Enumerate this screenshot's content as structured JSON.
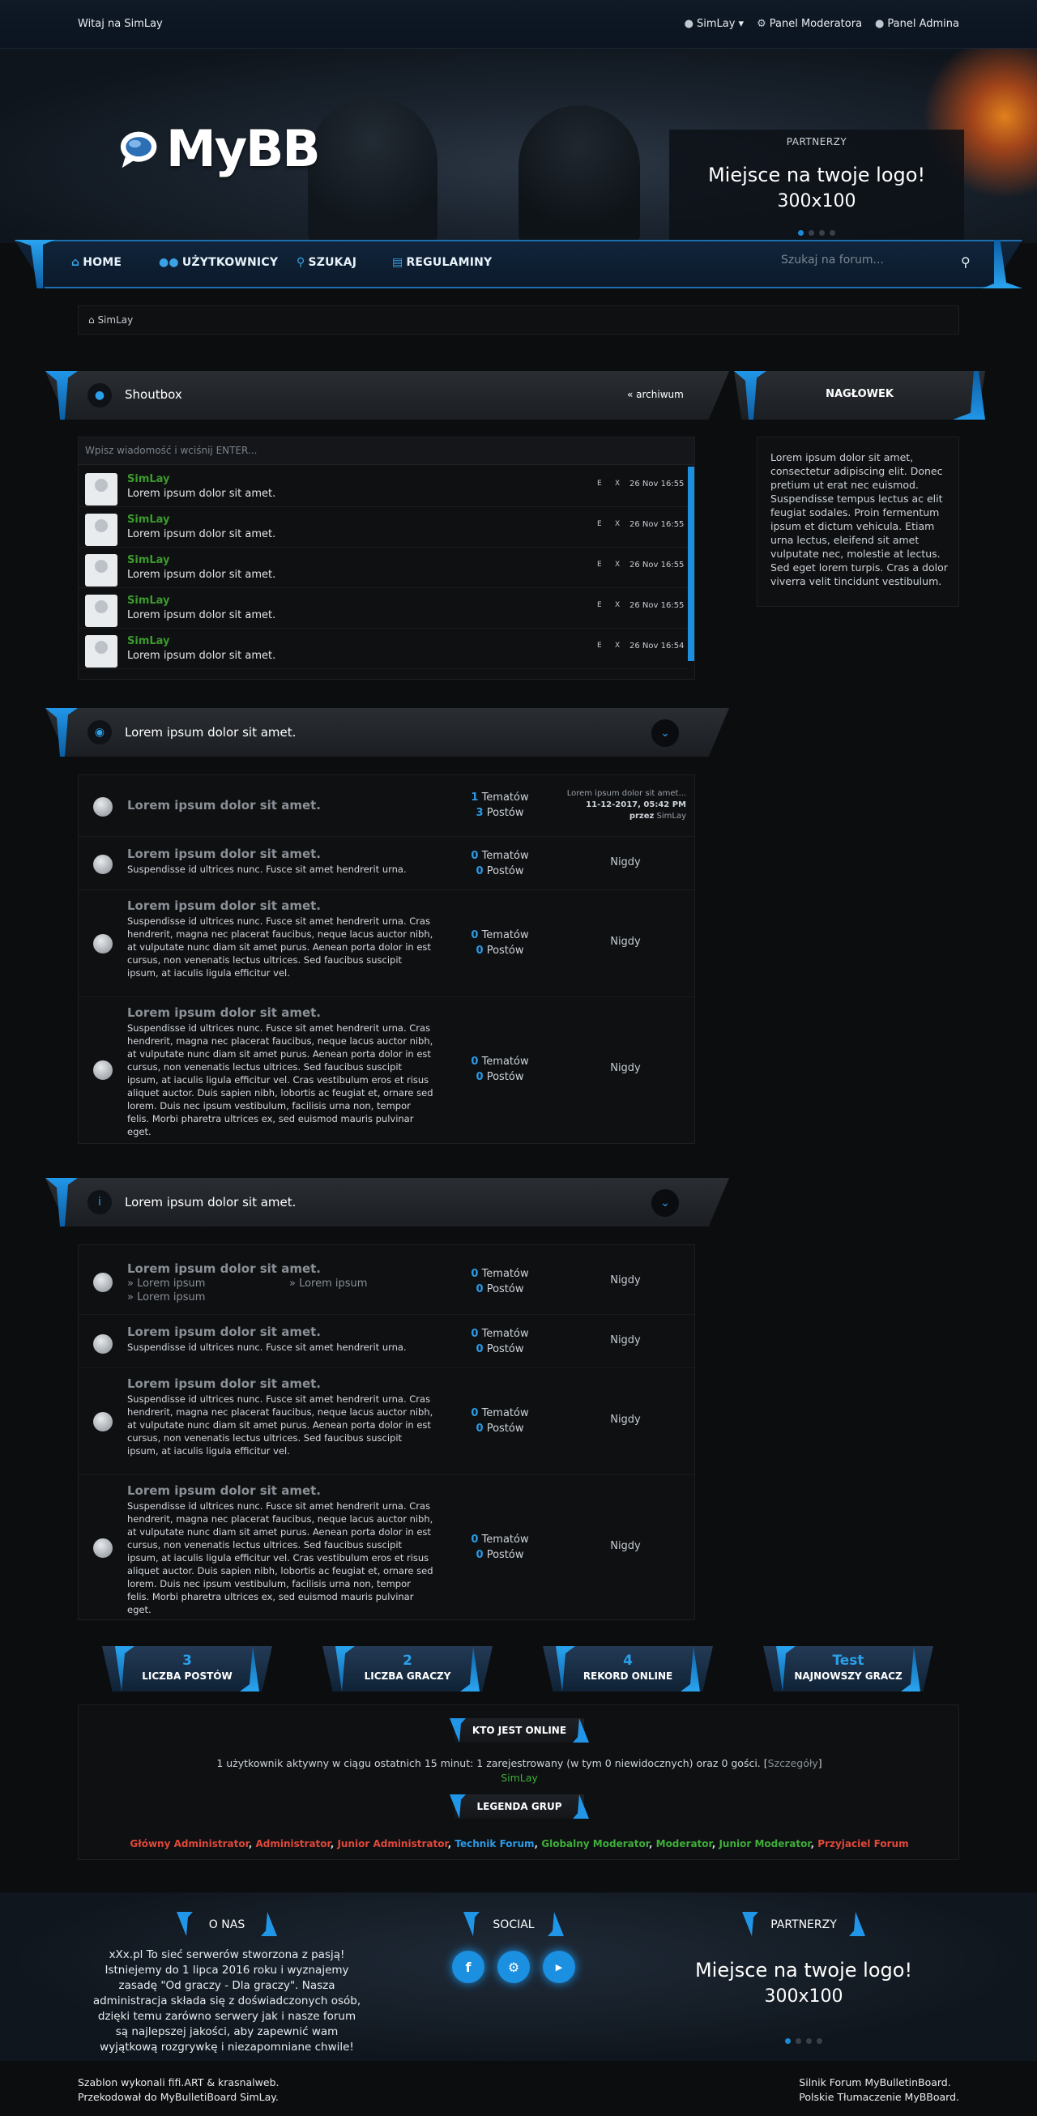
{
  "topbar": {
    "welcome": "Witaj na SimLay",
    "user": "SimLay",
    "moderator": "Panel Moderatora",
    "admin": "Panel Admina"
  },
  "header": {
    "logo": "MyBB",
    "partners_title": "PARTNERZY",
    "partners_line1": "Miejsce na twoje logo!",
    "partners_line2": "300x100"
  },
  "nav": {
    "items": [
      "HOME",
      "UŻYTKOWNICY",
      "SZUKAJ",
      "REGULAMINY"
    ],
    "search_placeholder": "Szukaj na forum..."
  },
  "breadcrumb": "SimLay",
  "shoutbox": {
    "title": "Shoutbox",
    "archive": "« archiwum",
    "input_placeholder": "Wpisz wiadomość i wciśnij ENTER...",
    "rows": [
      {
        "user": "SimLay",
        "message": "Lorem ipsum dolor sit amet.",
        "e": "E",
        "x": "X",
        "date": "26 Nov 16:55"
      },
      {
        "user": "SimLay",
        "message": "Lorem ipsum dolor sit amet.",
        "e": "E",
        "x": "X",
        "date": "26 Nov 16:55"
      },
      {
        "user": "SimLay",
        "message": "Lorem ipsum dolor sit amet.",
        "e": "E",
        "x": "X",
        "date": "26 Nov 16:55"
      },
      {
        "user": "SimLay",
        "message": "Lorem ipsum dolor sit amet.",
        "e": "E",
        "x": "X",
        "date": "26 Nov 16:55"
      },
      {
        "user": "SimLay",
        "message": "Lorem ipsum dolor sit amet.",
        "e": "E",
        "x": "X",
        "date": "26 Nov 16:54"
      }
    ]
  },
  "sidebar": {
    "title": "NAGŁOWEK",
    "text": "Lorem ipsum dolor sit amet, consectetur adipiscing elit. Donec pretium ut erat nec euismod. Suspendisse tempus lectus ac elit feugiat sodales. Proin fermentum ipsum et dictum vehicula. Etiam urna lectus, eleifend sit amet vulputate nec, molestie at lectus. Sed eget lorem turpis. Cras a dolor viverra velit tincidunt vestibulum."
  },
  "category1": {
    "title": "Lorem ipsum dolor sit amet.",
    "forums": [
      {
        "title": "Lorem ipsum dolor sit amet.",
        "desc": "",
        "topics": "1",
        "topics_label": "Tematów",
        "posts": "3",
        "posts_label": "Postów",
        "last_title": "Lorem ipsum dolor sit amet...",
        "last_date": "11-12-2017, 05:42 PM",
        "last_by": "przez",
        "last_user": "SimLay"
      },
      {
        "title": "Lorem ipsum dolor sit amet.",
        "desc": "Suspendisse id ultrices nunc. Fusce sit amet hendrerit urna.",
        "topics": "0",
        "topics_label": "Tematów",
        "posts": "0",
        "posts_label": "Postów",
        "last": "Nigdy"
      },
      {
        "title": "Lorem ipsum dolor sit amet.",
        "desc": "Suspendisse id ultrices nunc. Fusce sit amet hendrerit urna. Cras hendrerit, magna nec placerat faucibus, neque lacus auctor nibh, at vulputate nunc diam sit amet purus. Aenean porta dolor in est cursus, non venenatis lectus ultrices. Sed faucibus suscipit ipsum, at iaculis ligula efficitur vel.",
        "topics": "0",
        "topics_label": "Tematów",
        "posts": "0",
        "posts_label": "Postów",
        "last": "Nigdy"
      },
      {
        "title": "Lorem ipsum dolor sit amet.",
        "desc": "Suspendisse id ultrices nunc. Fusce sit amet hendrerit urna. Cras hendrerit, magna nec placerat faucibus, neque lacus auctor nibh, at vulputate nunc diam sit amet purus. Aenean porta dolor in est cursus, non venenatis lectus ultrices. Sed faucibus suscipit ipsum, at iaculis ligula efficitur vel. Cras vestibulum eros et risus aliquet auctor. Duis sapien nibh, lobortis ac feugiat et, ornare sed lorem. Duis nec ipsum vestibulum, facilisis urna non, tempor felis. Morbi pharetra ultrices ex, sed euismod mauris pulvinar eget.",
        "topics": "0",
        "topics_label": "Tematów",
        "posts": "0",
        "posts_label": "Postów",
        "last": "Nigdy"
      }
    ]
  },
  "category2": {
    "title": "Lorem ipsum dolor sit amet.",
    "forums": [
      {
        "title": "Lorem ipsum dolor sit amet.",
        "subforums": [
          "Lorem ipsum",
          "Lorem ipsum",
          "Lorem ipsum"
        ],
        "topics": "0",
        "topics_label": "Tematów",
        "posts": "0",
        "posts_label": "Postów",
        "last": "Nigdy"
      },
      {
        "title": "Lorem ipsum dolor sit amet.",
        "desc": "Suspendisse id ultrices nunc. Fusce sit amet hendrerit urna.",
        "topics": "0",
        "topics_label": "Tematów",
        "posts": "0",
        "posts_label": "Postów",
        "last": "Nigdy"
      },
      {
        "title": "Lorem ipsum dolor sit amet.",
        "desc": "Suspendisse id ultrices nunc. Fusce sit amet hendrerit urna. Cras hendrerit, magna nec placerat faucibus, neque lacus auctor nibh, at vulputate nunc diam sit amet purus. Aenean porta dolor in est cursus, non venenatis lectus ultrices. Sed faucibus suscipit ipsum, at iaculis ligula efficitur vel.",
        "topics": "0",
        "topics_label": "Tematów",
        "posts": "0",
        "posts_label": "Postów",
        "last": "Nigdy"
      },
      {
        "title": "Lorem ipsum dolor sit amet.",
        "desc": "Suspendisse id ultrices nunc. Fusce sit amet hendrerit urna. Cras hendrerit, magna nec placerat faucibus, neque lacus auctor nibh, at vulputate nunc diam sit amet purus. Aenean porta dolor in est cursus, non venenatis lectus ultrices. Sed faucibus suscipit ipsum, at iaculis ligula efficitur vel. Cras vestibulum eros et risus aliquet auctor. Duis sapien nibh, lobortis ac feugiat et, ornare sed lorem. Duis nec ipsum vestibulum, facilisis urna non, tempor felis. Morbi pharetra ultrices ex, sed euismod mauris pulvinar eget.",
        "topics": "0",
        "topics_label": "Tematów",
        "posts": "0",
        "posts_label": "Postów",
        "last": "Nigdy"
      }
    ]
  },
  "stats": [
    {
      "value": "3",
      "label": "LICZBA POSTÓW"
    },
    {
      "value": "2",
      "label": "LICZBA GRACZY"
    },
    {
      "value": "4",
      "label": "REKORD ONLINE"
    },
    {
      "value": "Test",
      "label": "NAJNOWSZY GRACZ"
    }
  ],
  "online": {
    "title": "KTO JEST ONLINE",
    "text": "1 użytkownik aktywny w ciągu ostatnich 15 minut: 1 zarejestrowany (w tym 0 niewidocznych) oraz 0 gości. [",
    "details": "Szczegóły",
    "close": "]",
    "user": "SimLay",
    "legend_title": "LEGENDA GRUP",
    "groups": [
      {
        "name": "Główny Administrator",
        "color": "#e0483a"
      },
      {
        "name": "Administrator",
        "color": "#e0483a"
      },
      {
        "name": "Junior Administrator",
        "color": "#e0483a"
      },
      {
        "name": "Technik Forum",
        "color": "#2a9ae6"
      },
      {
        "name": "Globalny Moderator",
        "color": "#3fae3a"
      },
      {
        "name": "Moderator",
        "color": "#3fae3a"
      },
      {
        "name": "Junior Moderator",
        "color": "#3fae3a"
      },
      {
        "name": "Przyjaciel Forum",
        "color": "#e0483a"
      }
    ]
  },
  "footer": {
    "about_title": "O NAS",
    "about_text": "xXx.pl To sieć serwerów stworzona z pasją! Istniejemy do 1 lipca 2016 roku i wyznajemy zasadę \"Od graczy - Dla graczy\". Nasza administracja składa się z doświadczonych osób, dzięki temu zarówno serwery jak i nasze forum są najlepszej jakości, aby zapewnić wam wyjątkową rozgrywkę i niezapomniane chwile!",
    "social_title": "SOCIAL",
    "partners_title": "PARTNERZY",
    "partners_line1": "Miejsce na twoje logo!",
    "partners_line2": "300x100"
  },
  "bottom": {
    "left1": "Szablon wykonali fifi.ART & krasnalweb.",
    "left2": "Przekodował do MyBulletiBoard SimLay.",
    "right1": "Silnik Forum MyBulletinBoard.",
    "right2": "Polskie Tłumaczenie MyBBoard."
  }
}
